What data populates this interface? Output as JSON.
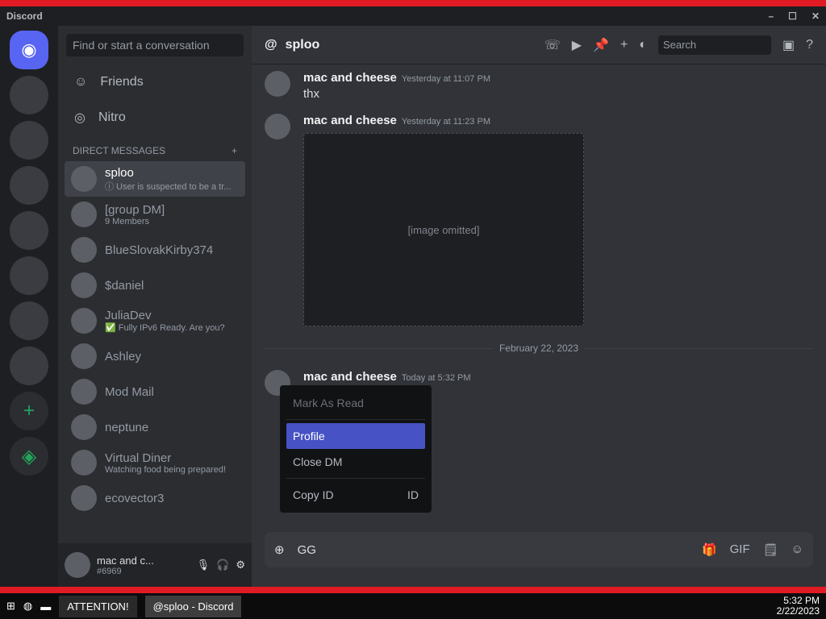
{
  "window": {
    "title": "Discord",
    "controls": [
      "–",
      "☐",
      "✕"
    ]
  },
  "guilds": [
    "",
    "",
    "",
    "",
    "",
    "",
    "",
    ""
  ],
  "dms": {
    "search_placeholder": "Find or start a conversation",
    "nav": [
      {
        "label": "Friends",
        "icon": "friends-icon"
      },
      {
        "label": "Nitro",
        "icon": "nitro-icon"
      }
    ],
    "header": "DIRECT MESSAGES",
    "items": [
      {
        "name": "sploo",
        "sub": "ⓘ User is suspected to be a tr...",
        "active": true
      },
      {
        "name": "[group DM]",
        "sub": "9 Members"
      },
      {
        "name": "BlueSlovakKirby374",
        "sub": ""
      },
      {
        "name": "$daniel",
        "sub": ""
      },
      {
        "name": "JuliaDev",
        "sub": "✅ Fully IPv6 Ready. Are you?"
      },
      {
        "name": "Ashley",
        "sub": ""
      },
      {
        "name": "Mod Mail",
        "sub": ""
      },
      {
        "name": "neptune",
        "sub": ""
      },
      {
        "name": "Virtual Diner",
        "sub": "Watching food being prepared!"
      },
      {
        "name": "ecovector3",
        "sub": ""
      }
    ],
    "user": {
      "name": "mac and c...",
      "tag": "#6969"
    }
  },
  "channel": {
    "name": "sploo",
    "search": "Search"
  },
  "messages": [
    {
      "author": "mac and cheese",
      "time": "Yesterday at 11:07 PM",
      "text": "thx"
    },
    {
      "author": "mac and cheese",
      "time": "Yesterday at 11:23 PM",
      "text": "",
      "attachment": "[image omitted]"
    }
  ],
  "divider": "February 22, 2023",
  "last_message": {
    "author": "mac and cheese",
    "time": "Today at 5:32 PM"
  },
  "context_menu": {
    "mark_read": "Mark As Read",
    "profile": "Profile",
    "close_dm": "Close DM",
    "copy_id": "Copy ID",
    "id_badge": "ID"
  },
  "composer": {
    "value": "GG",
    "tools": [
      "🎁",
      "GIF",
      "🗒",
      "☺"
    ]
  },
  "taskbar": {
    "tasks": [
      "ATTENTION!",
      "@sploo - Discord"
    ],
    "time": "5:32 PM",
    "date": "2/22/2023"
  }
}
